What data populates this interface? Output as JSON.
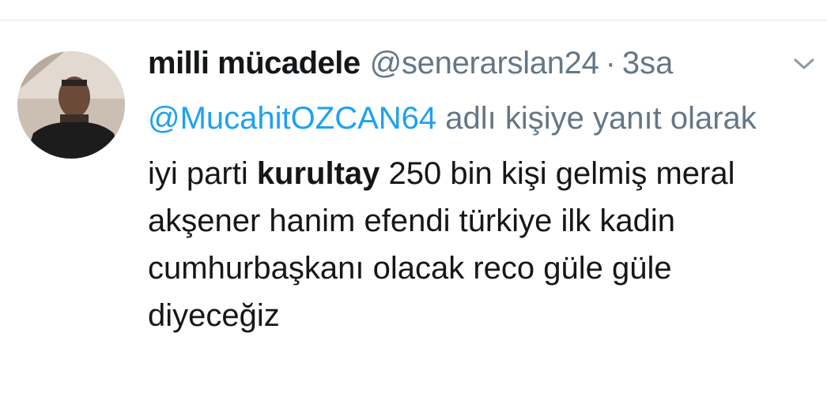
{
  "tweet": {
    "display_name": "milli mücadele",
    "handle": "@senerarslan24",
    "separator": "·",
    "time": "3sa",
    "reply": {
      "mention": "@MucahitOZCAN64",
      "suffix": " adlı kişiye yanıt olarak"
    },
    "text": {
      "before": "iyi parti ",
      "bold": "kurultay",
      "after": " 250 bin kişi gelmiş meral akşener hanim efendi türkiye ilk kadin cumhurbaşkanı olacak reco güle güle diyeceğiz"
    }
  },
  "icons": {
    "menu": "chevron-down-icon",
    "avatar": "profile-photo"
  },
  "colors": {
    "name": "#14171a",
    "secondary": "#657786",
    "link": "#1da1f2",
    "divider": "#e1e8ed"
  }
}
